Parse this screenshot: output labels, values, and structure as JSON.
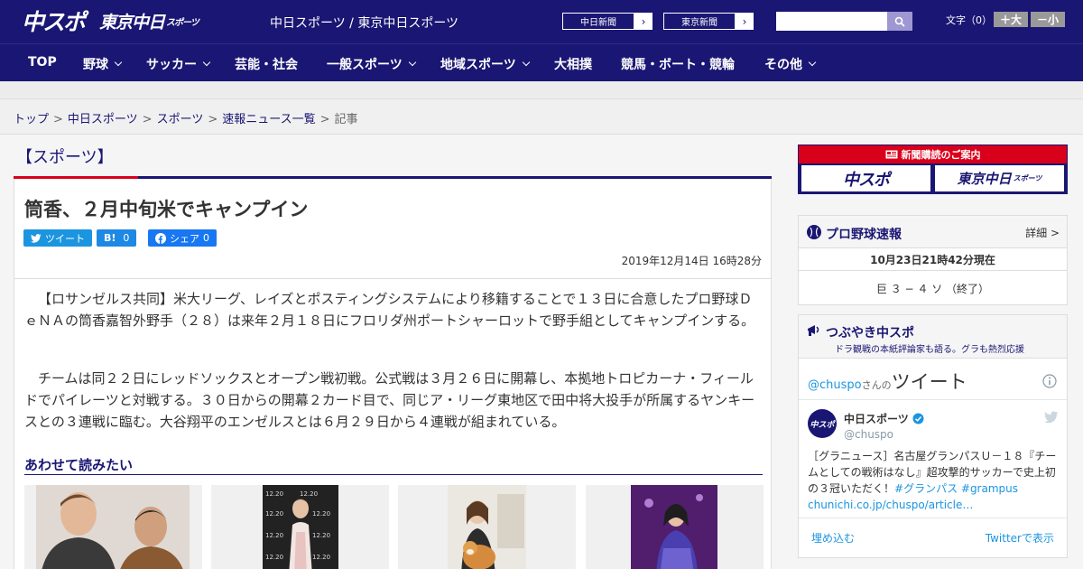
{
  "header": {
    "logo_chuspo": "中スポ",
    "logo_tokyo": "東京中日",
    "logo_tokyo_sub": "スポーツ",
    "site_title": "中日スポーツ / 東京中日スポーツ",
    "ext_links": [
      {
        "label": "中日新聞",
        "arrow": "›"
      },
      {
        "label": "東京新聞",
        "arrow": "›"
      }
    ],
    "search_placeholder": "",
    "font_size_label": "文字（0）",
    "font_bigger": "＋大",
    "font_smaller": "－小"
  },
  "nav": [
    {
      "label": "TOP",
      "dropdown": false
    },
    {
      "label": "野球",
      "dropdown": true
    },
    {
      "label": "サッカー",
      "dropdown": true
    },
    {
      "label": "芸能・社会",
      "dropdown": false
    },
    {
      "label": "一般スポーツ",
      "dropdown": true
    },
    {
      "label": "地域スポーツ",
      "dropdown": true
    },
    {
      "label": "大相撲",
      "dropdown": false
    },
    {
      "label": "競馬・ボート・競輪",
      "dropdown": false
    },
    {
      "label": "その他",
      "dropdown": true
    }
  ],
  "breadcrumb": {
    "items": [
      "トップ",
      "中日スポーツ",
      "スポーツ",
      "速報ニュース一覧"
    ],
    "current": "記事",
    "separator": ">"
  },
  "article": {
    "category": "【スポーツ】",
    "title": "筒香、２月中旬米でキャンプイン",
    "share": {
      "tweet": "ツイート",
      "hatena_icon": "B!",
      "hatena_count": "0",
      "facebook": "シェア",
      "facebook_count": "0"
    },
    "date": "2019年12月14日 16時28分",
    "paragraphs": [
      "【ロサンゼルス共同】米大リーグ、レイズとポスティングシステムにより移籍することで１３日に合意したプロ野球ＤｅＮＡの筒香嘉智外野手（２８）は来年２月１８日にフロリダ州ポートシャーロットで野手組としてキャンプインする。",
      "チームは同２２日にレッドソックスとオープン戦初戦。公式戦は３月２６日に開幕し、本拠地トロピカーナ・フィールドでパイレーツと対戦する。３０日からの開幕２カード目で、同じア・リーグ東地区で田中将大投手が所属するヤンキースとの３連戦に臨む。大谷翔平のエンゼルスとは６月２９日から４連戦が組まれている。"
    ],
    "related_title": "あわせて読みたい"
  },
  "sidebar": {
    "subscribe": {
      "label": "新聞購読のご案内",
      "logo1": "中スポ",
      "logo2": "東京中日",
      "logo2_sub": "スポーツ"
    },
    "baseball": {
      "title": "プロ野球速報",
      "more": "詳細 >",
      "as_of": "10月23日21時42分現在",
      "score": "巨 ３ − ４ ソ （終了）"
    },
    "tweets": {
      "title": "つぶやき中スポ",
      "subtitle": "ドラ観戦の本紙評論家も語る。グラも熱烈応援",
      "handle_link": "@chuspo",
      "handle_suffix": "さんの",
      "tweet_word": "ツイート",
      "account_name": "中日スポーツ",
      "account_handle": "@chuspo",
      "avatar_text": "中スポ",
      "tweet_text_main": "［グラニュース］名古屋グランパスＵ－１８『チームとしての戦術はなし』超攻撃的サッカーで史上初の３冠いただく！",
      "tweet_tags": "#グランパス #grampus",
      "tweet_link": "chunichi.co.jp/chuspo/article…",
      "embed": "埋め込む",
      "view_on_twitter": "Twitterで表示"
    }
  },
  "colors": {
    "brand_navy": "#1a1673",
    "accent_red": "#d9001b",
    "twitter_blue": "#1b95e0"
  }
}
